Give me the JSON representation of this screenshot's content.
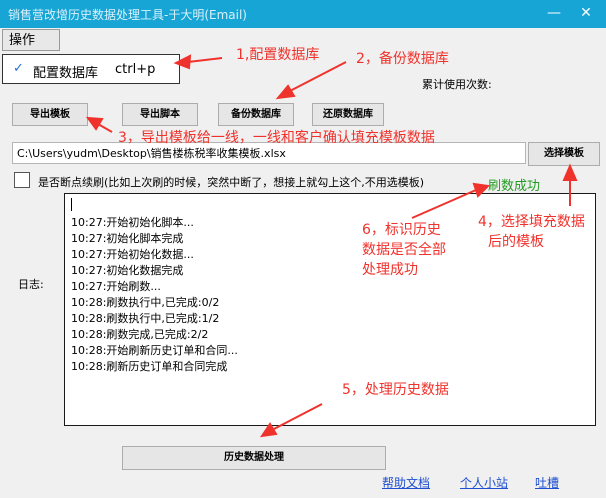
{
  "window": {
    "title": "销售营改增历史数据处理工具-于大明(Email)",
    "minimize_glyph": "—",
    "close_glyph": "✕"
  },
  "menu": {
    "operation_label": "操作",
    "dropdown": {
      "check_glyph": "✓",
      "item_label": "配置数据库",
      "shortcut": "ctrl+p"
    }
  },
  "usage": {
    "label": "累计使用次数:"
  },
  "toolbar": {
    "export_template": "导出模板",
    "export_script": "导出脚本",
    "backup_db": "备份数据库",
    "restore_db": "还原数据库",
    "select_template": "选择模板"
  },
  "file_path": {
    "value": "C:\\Users\\yudm\\Desktop\\销售楼栋税率收集模板.xlsx"
  },
  "resume": {
    "label": "是否断点续刷(比如上次刷的时候，突然中断了，想接上就勾上这个,不用选模板)"
  },
  "status": {
    "success": "刷数成功"
  },
  "log": {
    "label": "日志:",
    "lines": [
      "10:27:开始初始化脚本...",
      "10:27:初始化脚本完成",
      "10:27:开始初始化数据...",
      "10:27:初始化数据完成",
      "10:27:开始刷数...",
      "10:28:刷数执行中,已完成:0/2",
      "10:28:刷数执行中,已完成:1/2",
      "10:28:刷数完成,已完成:2/2",
      "10:28:开始刷新历史订单和合同...",
      "10:28:刷新历史订单和合同完成"
    ]
  },
  "actions": {
    "history_process": "历史数据处理"
  },
  "footer": {
    "help": "帮助文档",
    "site": "个人小站",
    "feedback": "吐槽"
  },
  "annotations": {
    "a1": "1,配置数据库",
    "a2": "2，备份数据库",
    "a3": "3，导出模板给一线，一线和客户确认填充模板数据",
    "a4_line1": "4，选择填充数据",
    "a4_line2": "后的模板",
    "a5": "5，处理历史数据",
    "a6_line1": "6，标识历史",
    "a6_line2": "数据是否全部",
    "a6_line3": "处理成功"
  },
  "colors": {
    "titlebar": "#17a5d6",
    "annotation": "#f0322c",
    "success": "#229b22",
    "link": "#1f4fd0"
  }
}
